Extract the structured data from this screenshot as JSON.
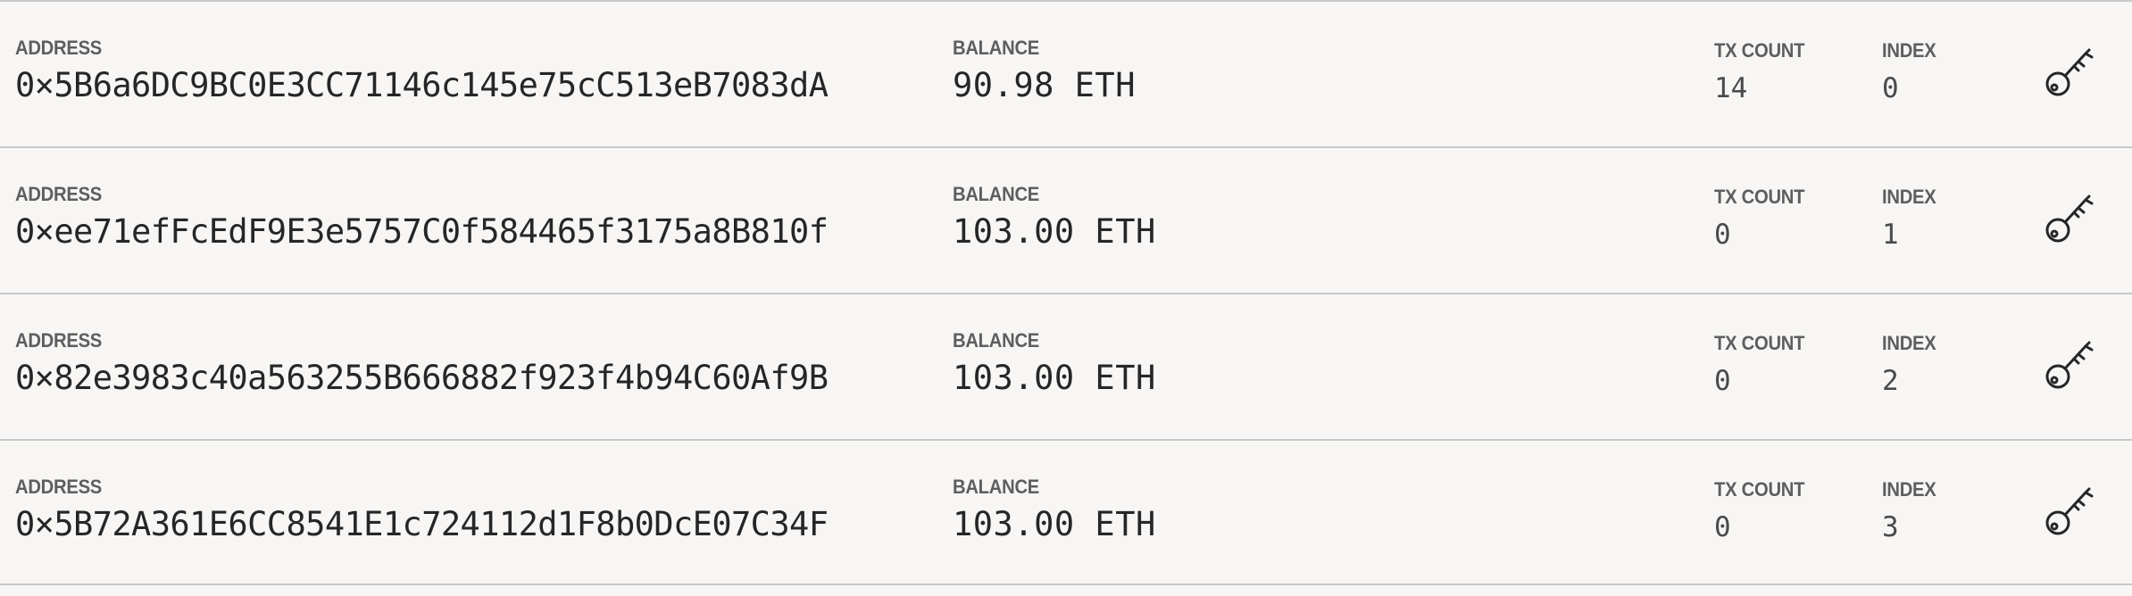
{
  "labels": {
    "address": "ADDRESS",
    "balance": "BALANCE",
    "tx_count": "TX COUNT",
    "index": "INDEX"
  },
  "accounts": [
    {
      "address": "0×5B6a6DC9BC0E3CC71146c145e75cC513eB7083dA",
      "balance": "90.98 ETH",
      "tx_count": "14",
      "index": "0",
      "key_icon": "key-icon"
    },
    {
      "address": "0×ee71efFcEdF9E3e5757C0f584465f3175a8B810f",
      "balance": "103.00 ETH",
      "tx_count": "0",
      "index": "1",
      "key_icon": "key-icon"
    },
    {
      "address": "0×82e3983c40a563255B666882f923f4b94C60Af9B",
      "balance": "103.00 ETH",
      "tx_count": "0",
      "index": "2",
      "key_icon": "key-icon"
    },
    {
      "address": "0×5B72A361E6CC8541E1c724112d1F8b0DcE07C34F",
      "balance": "103.00 ETH",
      "tx_count": "0",
      "index": "3",
      "key_icon": "key-icon"
    }
  ],
  "colors": {
    "background": "#f7f6f4",
    "divider": "#c8c8c8",
    "label": "#5e5e5e",
    "value": "#262626"
  }
}
